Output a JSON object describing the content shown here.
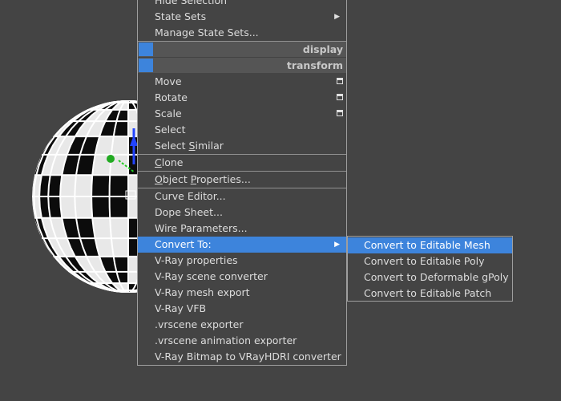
{
  "quad_menu": {
    "top_items": [
      {
        "label": "Hide Selection",
        "arrow": false
      },
      {
        "label": "State Sets",
        "arrow": true
      },
      {
        "label": "Manage State Sets...",
        "arrow": false
      }
    ],
    "headers": [
      "display",
      "transform"
    ],
    "transform_items": [
      {
        "label": "Move",
        "box": true
      },
      {
        "label": "Rotate",
        "box": true
      },
      {
        "label": "Scale",
        "box": true
      },
      {
        "label": "Select",
        "box": false
      },
      {
        "label_pre": "Select ",
        "label_ul": "S",
        "label_post": "imilar"
      }
    ],
    "clone": {
      "label_ul": "C",
      "label_post": "lone"
    },
    "object_properties": {
      "label_ul": "O",
      "label_post": "bject ",
      "label_ul2": "P",
      "label_post2": "roperties..."
    },
    "editor_items": [
      "Curve Editor...",
      "Dope Sheet...",
      "Wire Parameters..."
    ],
    "convert_to": "Convert To:",
    "vray_items": [
      "V-Ray properties",
      "V-Ray scene converter",
      "V-Ray mesh export",
      "V-Ray VFB",
      ".vrscene exporter",
      ".vrscene animation exporter",
      "V-Ray Bitmap to VRayHDRI converter"
    ]
  },
  "submenu": {
    "items": [
      "Convert to Editable Mesh",
      "Convert to Editable Poly",
      "Convert to Deformable gPoly",
      "Convert to Editable Patch"
    ]
  },
  "colors": {
    "background": "#444444",
    "highlight": "#3d84dc",
    "text": "#dcdcdc"
  }
}
